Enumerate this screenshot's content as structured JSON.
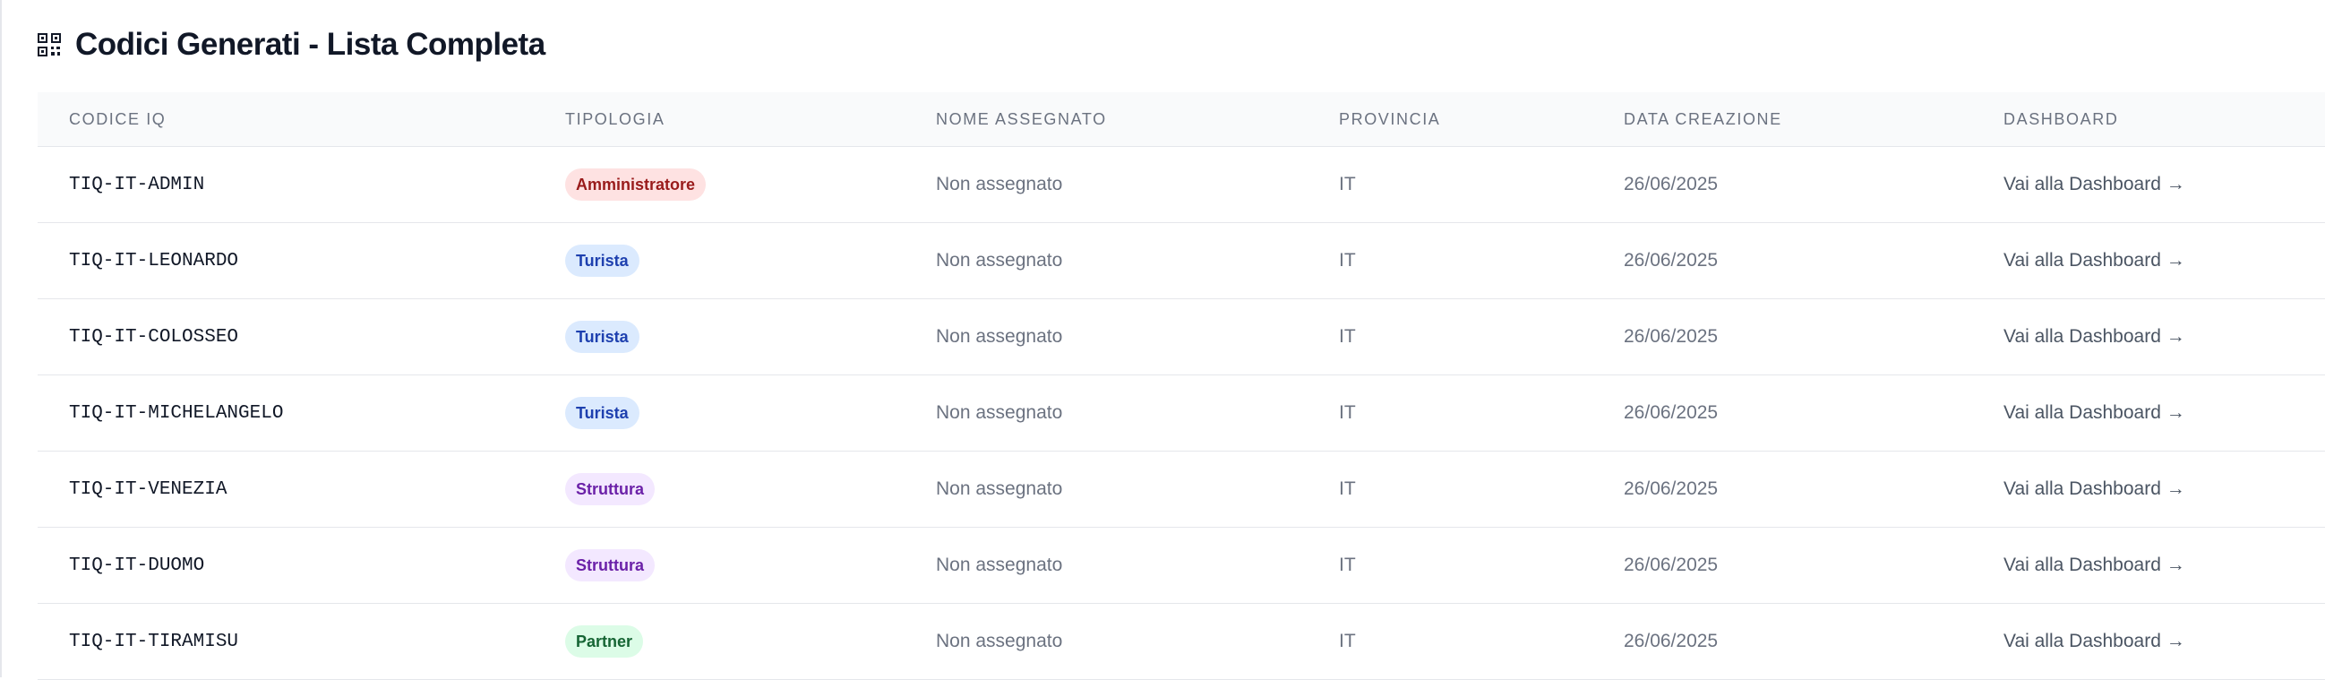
{
  "header": {
    "title": "Codici Generati - Lista Completa",
    "icon": "qr-code-icon"
  },
  "table": {
    "columns": [
      "CODICE IQ",
      "TIPOLOGIA",
      "NOME ASSEGNATO",
      "PROVINCIA",
      "DATA CREAZIONE",
      "DASHBOARD"
    ],
    "rows": [
      {
        "code": "TIQ-IT-ADMIN",
        "type": "Amministratore",
        "type_bg": "#fee2e2",
        "type_fg": "#991b1b",
        "name": "Non assegnato",
        "province": "IT",
        "date": "26/06/2025",
        "link": "Vai alla Dashboard →"
      },
      {
        "code": "TIQ-IT-LEONARDO",
        "type": "Turista",
        "type_bg": "#dbeafe",
        "type_fg": "#1e40af",
        "name": "Non assegnato",
        "province": "IT",
        "date": "26/06/2025",
        "link": "Vai alla Dashboard →"
      },
      {
        "code": "TIQ-IT-COLOSSEO",
        "type": "Turista",
        "type_bg": "#dbeafe",
        "type_fg": "#1e40af",
        "name": "Non assegnato",
        "province": "IT",
        "date": "26/06/2025",
        "link": "Vai alla Dashboard →"
      },
      {
        "code": "TIQ-IT-MICHELANGELO",
        "type": "Turista",
        "type_bg": "#dbeafe",
        "type_fg": "#1e40af",
        "name": "Non assegnato",
        "province": "IT",
        "date": "26/06/2025",
        "link": "Vai alla Dashboard →"
      },
      {
        "code": "TIQ-IT-VENEZIA",
        "type": "Struttura",
        "type_bg": "#f3e8ff",
        "type_fg": "#6b21a8",
        "name": "Non assegnato",
        "province": "IT",
        "date": "26/06/2025",
        "link": "Vai alla Dashboard →"
      },
      {
        "code": "TIQ-IT-DUOMO",
        "type": "Struttura",
        "type_bg": "#f3e8ff",
        "type_fg": "#6b21a8",
        "name": "Non assegnato",
        "province": "IT",
        "date": "26/06/2025",
        "link": "Vai alla Dashboard →"
      },
      {
        "code": "TIQ-IT-TIRAMISU",
        "type": "Partner",
        "type_bg": "#dcfce7",
        "type_fg": "#166534",
        "name": "Non assegnato",
        "province": "IT",
        "date": "26/06/2025",
        "link": "Vai alla Dashboard →"
      }
    ]
  }
}
